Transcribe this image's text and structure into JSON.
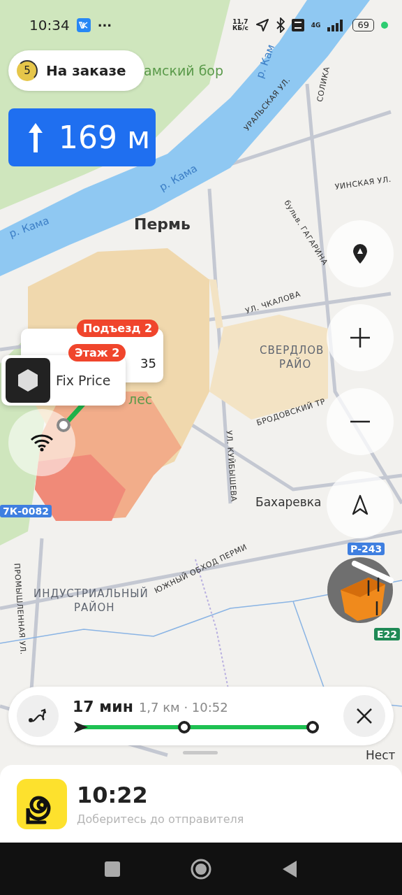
{
  "status_bar": {
    "time": "10:34",
    "more": "···",
    "speed_value": "11,7",
    "speed_unit": "КБ/с",
    "network": "4G",
    "battery": "69"
  },
  "order_status": {
    "count": "5",
    "label": "На заказе"
  },
  "maneuver": {
    "distance": "169 м"
  },
  "map": {
    "labels": [
      {
        "text": "амский бор",
        "kind": "park"
      },
      {
        "text": "р. Кам",
        "kind": "water"
      },
      {
        "text": "р. Кама",
        "kind": "water"
      },
      {
        "text": "р. Кама",
        "kind": "water"
      },
      {
        "text": "УРАЛЬСКАЯ УЛ.",
        "kind": "street"
      },
      {
        "text": "СОЛИКА",
        "kind": "street"
      },
      {
        "text": "УИНСКАЯ УЛ.",
        "kind": "street"
      },
      {
        "text": "бульв. ГАГАРИНА",
        "kind": "street"
      },
      {
        "text": "Пермь",
        "kind": "city"
      },
      {
        "text": "УЛ. ЧКАЛОВА",
        "kind": "street"
      },
      {
        "text": "СВЕРДЛОВ",
        "kind": "district"
      },
      {
        "text": "РАЙО",
        "kind": "district"
      },
      {
        "text": "БРОДОВСКИЙ ТР",
        "kind": "street"
      },
      {
        "text": "УЛ. КУЙБЫШЕВА",
        "kind": "street"
      },
      {
        "text": "Бахаревка",
        "kind": "place"
      },
      {
        "text": "7К-0082",
        "kind": "road_number"
      },
      {
        "text": "Р-243",
        "kind": "road_number"
      },
      {
        "text": "Е22",
        "kind": "euro_road"
      },
      {
        "text": "ПРОМЫШЛЕННАЯ УЛ.",
        "kind": "street"
      },
      {
        "text": "ИНДУСТРИАЛЬНЫЙ",
        "kind": "district"
      },
      {
        "text": "РАЙОН",
        "kind": "district"
      },
      {
        "text": "ЮЖНЫЙ ОБХОД ПЕРМИ",
        "kind": "street"
      },
      {
        "text": "лес",
        "kind": "park"
      },
      {
        "text": "Нест",
        "kind": "place"
      }
    ]
  },
  "pickup_popup": {
    "tags": [
      "Подъезд 2",
      "Этаж 2"
    ],
    "back_text": "35",
    "place_name": "Fix Price"
  },
  "route": {
    "duration": "17 мин",
    "details": "1,7 км · 10:52"
  },
  "task": {
    "time": "10:22",
    "hint": "Доберитесь до отправителя"
  }
}
